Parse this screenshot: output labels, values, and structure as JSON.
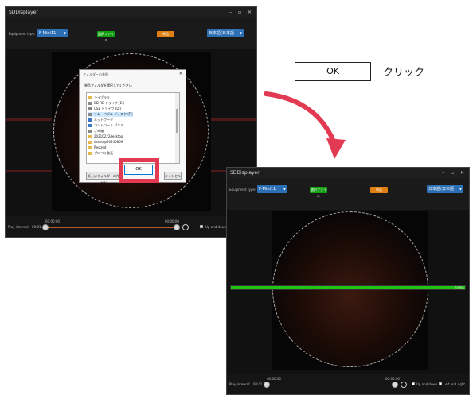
{
  "window_a": {
    "title": "SDDIsplayer",
    "controls": "– ▫ ✕",
    "equipment_label": "Equipment type:",
    "equipment_value": "F-Mini11",
    "select_file_label": "選択ファイル",
    "orange_btn_label": "単品",
    "language_value": "日本語(日本語",
    "dialog": {
      "title": "フォルダーの参照",
      "close": "✕",
      "prompt": "単品フォルダを選択してください",
      "tree": [
        {
          "label": "ライブラリ",
          "icon": "folder"
        },
        {
          "label": "BD-RE ドライブ (E:)",
          "icon": "drive"
        },
        {
          "label": "USB ドライブ (D:)",
          "icon": "drive"
        },
        {
          "label": "リムーバブル ディスク (F:)",
          "icon": "drive",
          "selected": true
        },
        {
          "label": "ネットワーク",
          "icon": "network"
        },
        {
          "label": "コントロール パネル",
          "icon": "panel"
        },
        {
          "label": "ごみ箱",
          "icon": "trash"
        },
        {
          "label": "20210222desktop",
          "icon": "folder"
        },
        {
          "label": "desktop20240809",
          "icon": "folder"
        },
        {
          "label": "Resized",
          "icon": "folder"
        },
        {
          "label": "プロペラ動画",
          "icon": "folder"
        }
      ],
      "new_folder_label": "新しいフォルダーの作成(N)",
      "ok_label": "OK",
      "cancel_label": "キャンセル"
    },
    "bottom": {
      "play_interval_label": "Play interval:",
      "play_interval_value": "00:01",
      "time_start": "00:00:00",
      "time_end": "00:00:00",
      "updown_label": "Up and down"
    }
  },
  "legend": {
    "ok_label": "OK",
    "click_text": "クリック",
    "highlight_color": "#e23a52",
    "arrow_color": "#e23a52"
  },
  "window_b": {
    "title": "SDDisplayer",
    "controls": "– ▫ ✕",
    "equipment_label": "Equipment type:",
    "equipment_value": "F-Mini11",
    "select_file_label": "選択ファイル",
    "orange_btn_label": "単品",
    "language_value": "日本語(日本語",
    "progress_fraction": 1.0,
    "progress_text": "100%",
    "progress_color": "#21c414",
    "bottom": {
      "play_interval_label": "Play interval:",
      "play_interval_value": "00:01",
      "time_start": "00:00:00",
      "time_end": "00:00:00",
      "updown_label": "Up and down",
      "leftright_label": "Left and right"
    }
  }
}
